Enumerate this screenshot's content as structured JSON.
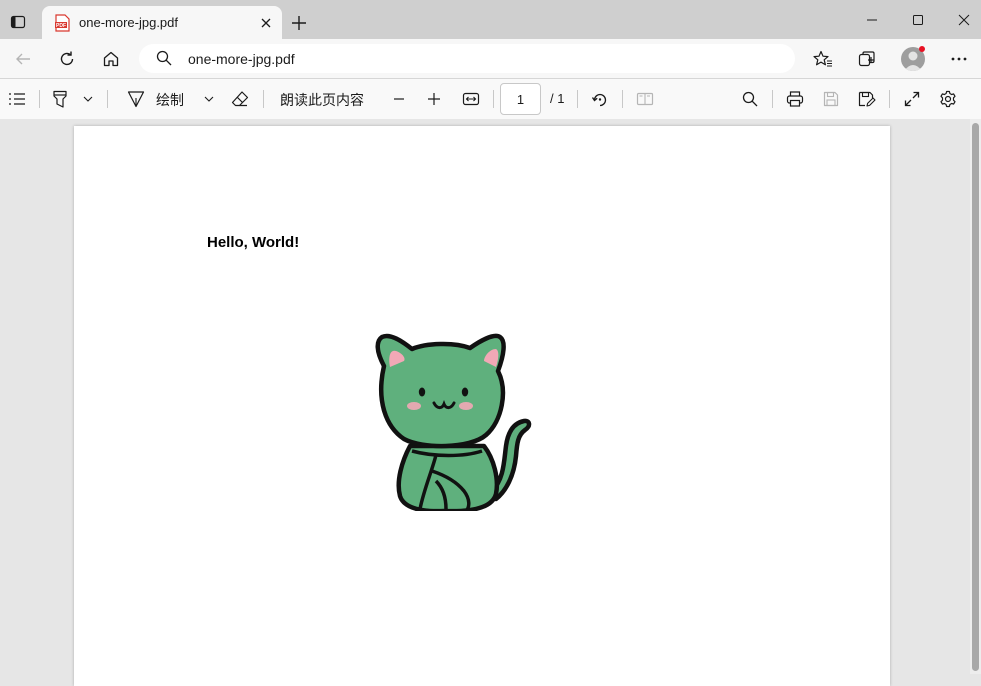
{
  "tab": {
    "title": "one-more-jpg.pdf",
    "favicon_text": "PDF"
  },
  "address_bar": {
    "url": "one-more-jpg.pdf"
  },
  "pdf_toolbar": {
    "draw_label": "绘制",
    "read_aloud_label": "朗读此页内容",
    "page_current": "1",
    "page_total": "/ 1"
  },
  "document": {
    "text": "Hello, World!",
    "image_name": "green-cat-illustration"
  },
  "colors": {
    "tabbar_bg": "#cfcfcf",
    "toolbar_bg": "#f7f7f7",
    "viewer_bg": "#e6e6e6",
    "cat_green": "#5fb07d",
    "pdf_icon_red": "#d9382f",
    "notification_dot": "#e81123"
  }
}
